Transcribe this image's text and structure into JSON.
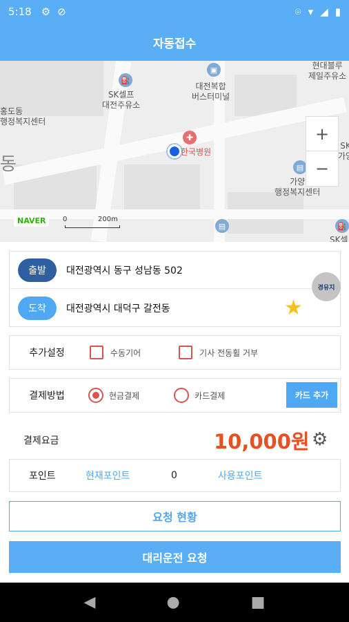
{
  "status_bar": {
    "time": "5:18"
  },
  "app_bar": {
    "title": "자동접수"
  },
  "map": {
    "labels": {
      "sk_self": "SK셀프\n대전주유소",
      "bus_terminal": "대전복합\n버스터미널",
      "hyundai": "현대블루\n제일주유소",
      "hongdo": "홍도동\n행정복지센터",
      "dong": "동",
      "hospital": "한국병원",
      "gayang": "가양\n행정복지센터",
      "sk_right": "SK\n가양",
      "sk_bottom": "SK셀"
    },
    "naver": "NAVER",
    "scale_0": "0",
    "scale_200": "200m",
    "zoom_in": "+",
    "zoom_out": "−"
  },
  "route": {
    "departure_label": "출발",
    "departure_address": "대전광역시 동구 성남동 502",
    "arrival_label": "도착",
    "arrival_address": "대전광역시 대덕구 갈전동",
    "via_label": "경유지"
  },
  "options": {
    "label": "추가설정",
    "manual_gear": "수동기어",
    "refuse_call": "기사 전동휠 거부"
  },
  "payment": {
    "label": "결제방법",
    "cash": "현금결제",
    "card": "카드결제",
    "add_card": "카드 추가"
  },
  "fare": {
    "label": "결제요금",
    "value": "10,000원"
  },
  "points": {
    "label": "포인트",
    "current_label": "현재포인트",
    "current_value": "0",
    "use_label": "사용포인트"
  },
  "buttons": {
    "status": "요청 현황",
    "request": "대리운전 요청"
  }
}
